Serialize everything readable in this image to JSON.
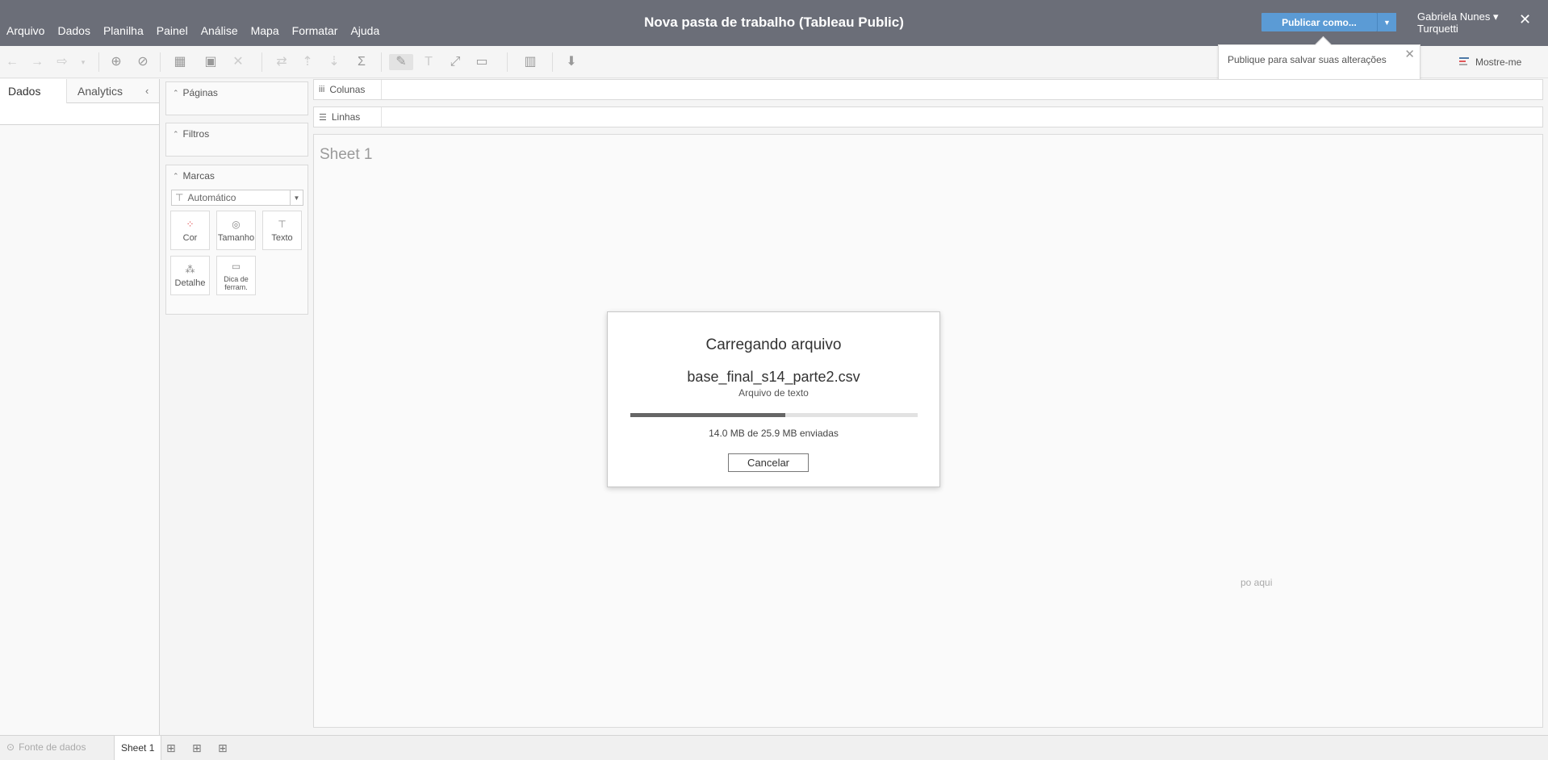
{
  "header": {
    "menu": [
      "Arquivo",
      "Dados",
      "Planilha",
      "Painel",
      "Análise",
      "Mapa",
      "Formatar",
      "Ajuda"
    ],
    "title": "Nova pasta de trabalho (Tableau Public)",
    "publish_label": "Publicar como...",
    "user_first": "Gabriela Nunes ▾",
    "user_last": "Turquetti"
  },
  "tooltip": {
    "text": "Publique para salvar suas alterações"
  },
  "toolbar": {
    "show_me_label": "Mostre-me"
  },
  "left_pane": {
    "tab_data": "Dados",
    "tab_analytics": "Analytics"
  },
  "cards": {
    "pages": "Páginas",
    "filters": "Filtros",
    "marks": "Marcas",
    "mark_type": "Automático",
    "mark_buttons": [
      "Cor",
      "Tamanho",
      "Texto",
      "Detalhe",
      "Dica de ferram."
    ]
  },
  "shelves": {
    "columns": "Colunas",
    "rows": "Linhas"
  },
  "canvas": {
    "sheet_title": "Sheet 1",
    "drop_hint": "po aqui"
  },
  "modal": {
    "title": "Carregando arquivo",
    "filename": "base_final_s14_parte2.csv",
    "file_type": "Arquivo de texto",
    "status": "14.0 MB de 25.9 MB enviadas",
    "progress": 0.54,
    "cancel_label": "Cancelar"
  },
  "bottom": {
    "data_source": "Fonte de dados",
    "sheet_tab": "Sheet 1"
  }
}
